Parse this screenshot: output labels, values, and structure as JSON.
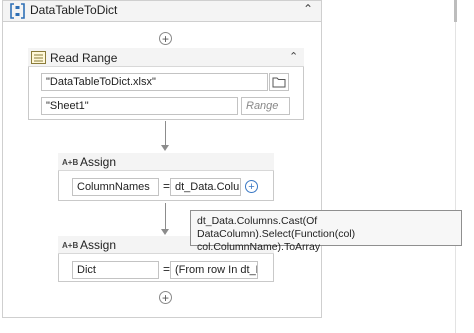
{
  "sequence": {
    "title": "DataTableToDict",
    "icon": "sequence-icon",
    "collapse_icon": "double-chevron-up-icon"
  },
  "read_range": {
    "title": "Read Range",
    "icon": "excel-read-range-icon",
    "collapse_icon": "double-chevron-up-icon",
    "workbook_path": "\"DataTableToDict.xlsx\"",
    "browse_icon": "folder-icon",
    "sheet_name": "\"Sheet1\"",
    "range_placeholder": "Range"
  },
  "assign_1": {
    "title": "Assign",
    "icon_label": "A+B",
    "to": "ColumnNames",
    "equals": "=",
    "value": "dt_Data.Colum",
    "add_icon": "plus-circle-icon"
  },
  "assign_2": {
    "title": "Assign",
    "icon_label": "A+B",
    "to": "Dict",
    "equals": "=",
    "value": "(From row In dt_Da"
  },
  "tooltip": {
    "line1": "dt_Data.Columns.Cast(Of DataColumn).Select(Function(col)",
    "line2": "col.ColumnName).ToArray"
  },
  "add_activity_symbol": "+"
}
